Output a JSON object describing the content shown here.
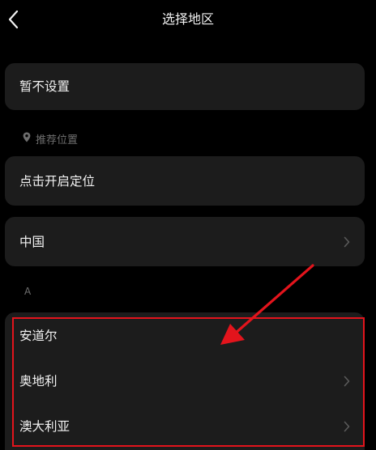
{
  "header": {
    "title": "选择地区"
  },
  "no_setting": {
    "label": "暂不设置"
  },
  "recommended": {
    "section_label": "推荐位置",
    "locate_label": "点击开启定位",
    "current_region": "中国"
  },
  "index_letter": "A",
  "regions": [
    {
      "name": "安道尔",
      "has_chevron": false
    },
    {
      "name": "奥地利",
      "has_chevron": true
    },
    {
      "name": "澳大利亚",
      "has_chevron": true
    }
  ],
  "colors": {
    "background": "#000000",
    "card": "#1c1c1c",
    "text": "#f2f2f2",
    "muted": "#6e6e6e",
    "annotation": "#e3141c"
  },
  "icons": {
    "back": "chevron-left-icon",
    "location": "location-pin-icon",
    "row": "chevron-right-icon"
  }
}
